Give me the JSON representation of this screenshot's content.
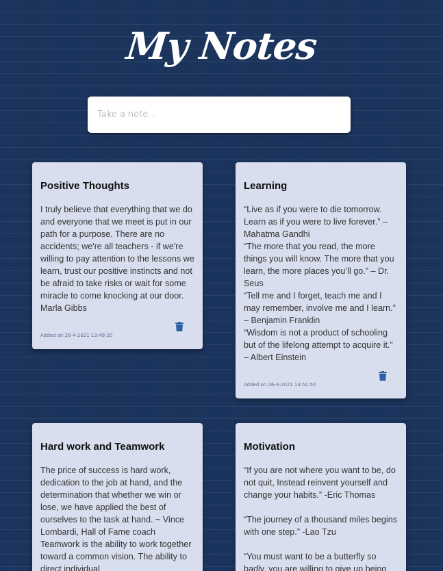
{
  "app": {
    "title": "My Notes"
  },
  "input": {
    "placeholder": "Take a note..."
  },
  "colors": {
    "background": "#1c355e",
    "card": "#d8deed",
    "delete_icon": "#2f5fa5"
  },
  "notes": [
    {
      "title": "Positive Thoughts",
      "body": "I truly believe that everything that we do and everyone that we meet is put in our path for a purpose. There are no accidents; we're all teachers - if we're willing to pay attention to the lessons we learn, trust our positive instincts and not be afraid to take risks or wait for some miracle to come knocking at our door. Marla Gibbs",
      "date": "Added on 26-4-2021 13:49:20",
      "delete_icon": "trash-icon"
    },
    {
      "title": "Learning",
      "body": "“Live as if you were to die tomorrow. Learn as if you were to live forever.” – Mahatma Gandhi\n“The more that you read, the more things you will know. The more that you learn, the more places you’ll go.” – Dr.  Seus\n “Tell me and I forget, teach me and I may remember, involve me and I learn.” – Benjamin Franklin\n “Wisdom is not a product of schooling but of the lifelong attempt to acquire it.” – Albert Einstein",
      "date": "Added on 26-4-2021 13:51:50",
      "delete_icon": "trash-icon"
    },
    {
      "title": "Hard work and Teamwork",
      "body": "The price of success is hard work, dedication to the job at hand, and the determination that whether we win or lose, we have applied the best of ourselves to the task at hand. ~ Vince Lombardi, Hall of Fame coach\nTeamwork is the ability to work together toward a common vision. The ability to direct individual",
      "date": "",
      "delete_icon": "trash-icon"
    },
    {
      "title": "Motivation",
      "body": "“If you are not where you want to be, do not quit, Instead reinvent yourself and change your habits.” -Eric Thomas\n\n“The journey of a thousand miles begins with one step.” -Lao Tzu\n\n“You must want to be a butterfly so badly, you are willing to give up being",
      "date": "",
      "delete_icon": "trash-icon"
    }
  ]
}
